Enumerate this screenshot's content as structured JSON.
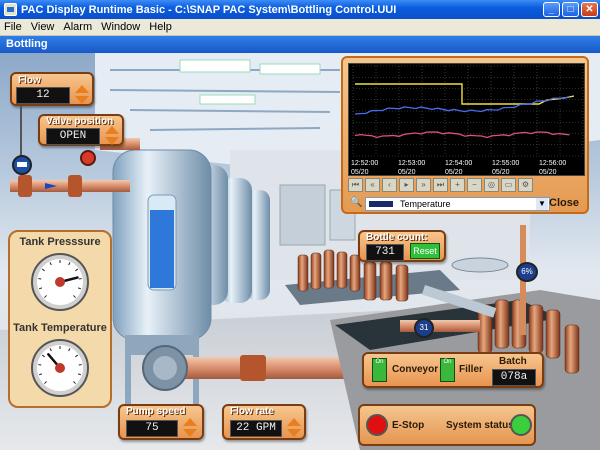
{
  "window": {
    "title": "PAC Display Runtime Basic - C:\\SNAP PAC System\\Bottling Control.UUI",
    "minimize": "_",
    "maximize": "□",
    "close": "✕"
  },
  "menu": [
    "File",
    "View",
    "Alarm",
    "Window",
    "Help"
  ],
  "screen_tab": "Bottling",
  "flow": {
    "label": "Flow",
    "value": "12"
  },
  "valve": {
    "label": "Valve position",
    "value": "OPEN"
  },
  "gauges": {
    "pressure_title": "Tank Presssure",
    "temperature_title": "Tank Temperature",
    "pressure_level": 0.78,
    "temperature_level": 0.35
  },
  "trend": {
    "time_labels": [
      "12:52:00",
      "12:53:00",
      "12:54:00",
      "12:55:00",
      "12:56:00"
    ],
    "date_label": "05/20",
    "selected_tag": "Temperature",
    "close_label": "Close",
    "colors": {
      "yellow": "#f0e040",
      "blue": "#4a6cf0",
      "pink": "#e0507a"
    }
  },
  "bottle_count": {
    "label": "Bottle count:",
    "value": "731",
    "reset_label": "Reset"
  },
  "bottle_markers": {
    "a": "6%",
    "b": "31"
  },
  "conveyor": {
    "on_label": "On",
    "label": "Conveyor"
  },
  "filler": {
    "on_label": "On",
    "label": "Filler"
  },
  "batch": {
    "label": "Batch",
    "value": "078a"
  },
  "pump_speed": {
    "label": "Pump speed",
    "value": "75"
  },
  "flow_rate": {
    "label": "Flow rate",
    "value": "22 GPM"
  },
  "estop": {
    "label": "E-Stop",
    "color": "#e01010"
  },
  "system_status": {
    "label": "System status",
    "color": "#3ccf3c"
  }
}
